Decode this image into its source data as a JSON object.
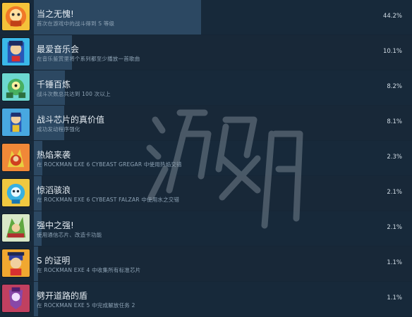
{
  "achievements": [
    {
      "title": "当之无愧!",
      "desc": "首次在游戏中的战斗得到 S 等级",
      "pct": "44.2%",
      "progress": 0.442,
      "icon": "achievement-badge-icon",
      "color": "#f07828"
    },
    {
      "title": "最爱音乐会",
      "desc": "在音乐鉴赏里将个系列都至少播放一首歌曲",
      "pct": "10.1%",
      "progress": 0.101,
      "icon": "music-navi-icon",
      "color": "#3070c8"
    },
    {
      "title": "千锤百炼",
      "desc": "战斗次数总共达到 100 次以上",
      "pct": "8.2%",
      "progress": 0.082,
      "icon": "robot-icon",
      "color": "#48b060"
    },
    {
      "title": "战斗芯片的真价值",
      "desc": "成功发动程序强化",
      "pct": "8.1%",
      "progress": 0.081,
      "icon": "battle-chip-icon",
      "color": "#2858b8"
    },
    {
      "title": "热焰来袭",
      "desc": "在 ROCKMAN EXE 6 CYBEAST GREGAR 中使用热焰交错",
      "pct": "2.3%",
      "progress": 0.023,
      "icon": "fire-beast-icon",
      "color": "#e86a28"
    },
    {
      "title": "惊滔骇浪",
      "desc": "在 ROCKMAN EXE 6 CYBEAST FALZAR 中使用水之交错",
      "pct": "2.1%",
      "progress": 0.021,
      "icon": "aqua-navi-icon",
      "color": "#38b0e0"
    },
    {
      "title": "强中之强!",
      "desc": "使用通信芯片、改造卡功能",
      "pct": "2.1%",
      "progress": 0.021,
      "icon": "fighter-navi-icon",
      "color": "#60a840"
    },
    {
      "title": "S 的证明",
      "desc": "在 ROCKMAN EXE 4 中收集所有标准芯片",
      "pct": "1.1%",
      "progress": 0.011,
      "icon": "hero-portrait-icon",
      "color": "#e8a828"
    },
    {
      "title": "劈开道路的盾",
      "desc": "在 ROCKMAN EXE 5 中完成解放任务 2",
      "pct": "1.1%",
      "progress": 0.011,
      "icon": "shield-knight-icon",
      "color": "#8848a8"
    }
  ],
  "watermark": {
    "text": "游侠网"
  }
}
